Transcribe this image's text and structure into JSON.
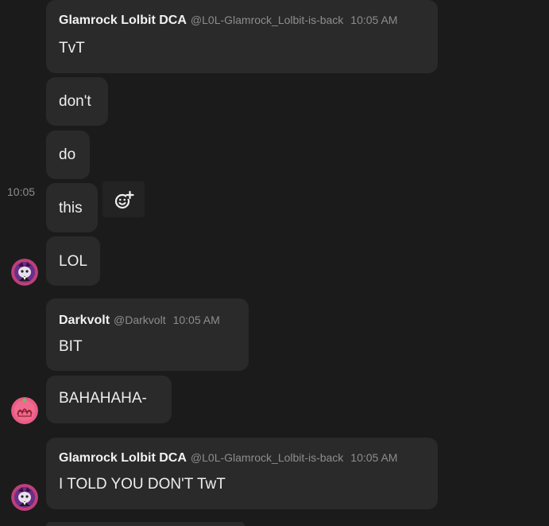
{
  "hover_time": "10:05",
  "messages": [
    {
      "name": "Glamrock Lolbit DCA",
      "handle": "@L0L-Glamrock_Lolbit-is-back",
      "time": "10:05 AM",
      "text": "TvT"
    },
    {
      "text": "don't"
    },
    {
      "text": "do"
    },
    {
      "text": "this"
    },
    {
      "text": "LOL"
    },
    {
      "name": "Darkvolt",
      "handle": "@Darkvolt",
      "time": "10:05 AM",
      "text": "BIT"
    },
    {
      "text": "BAHAHAHA-"
    },
    {
      "name": "Glamrock Lolbit DCA",
      "handle": "@L0L-Glamrock_Lolbit-is-back",
      "time": "10:05 AM",
      "text": "I TOLD YOU DON'T TwT"
    }
  ],
  "icons": {
    "add_reaction": "add-reaction-icon",
    "avatar_lolbit": "lolbit-avatar",
    "avatar_darkvolt": "darkvolt-avatar"
  },
  "colors": {
    "background": "#1b1b1b",
    "bubble": "#2a2a2a",
    "muted": "#8d8d8d"
  }
}
